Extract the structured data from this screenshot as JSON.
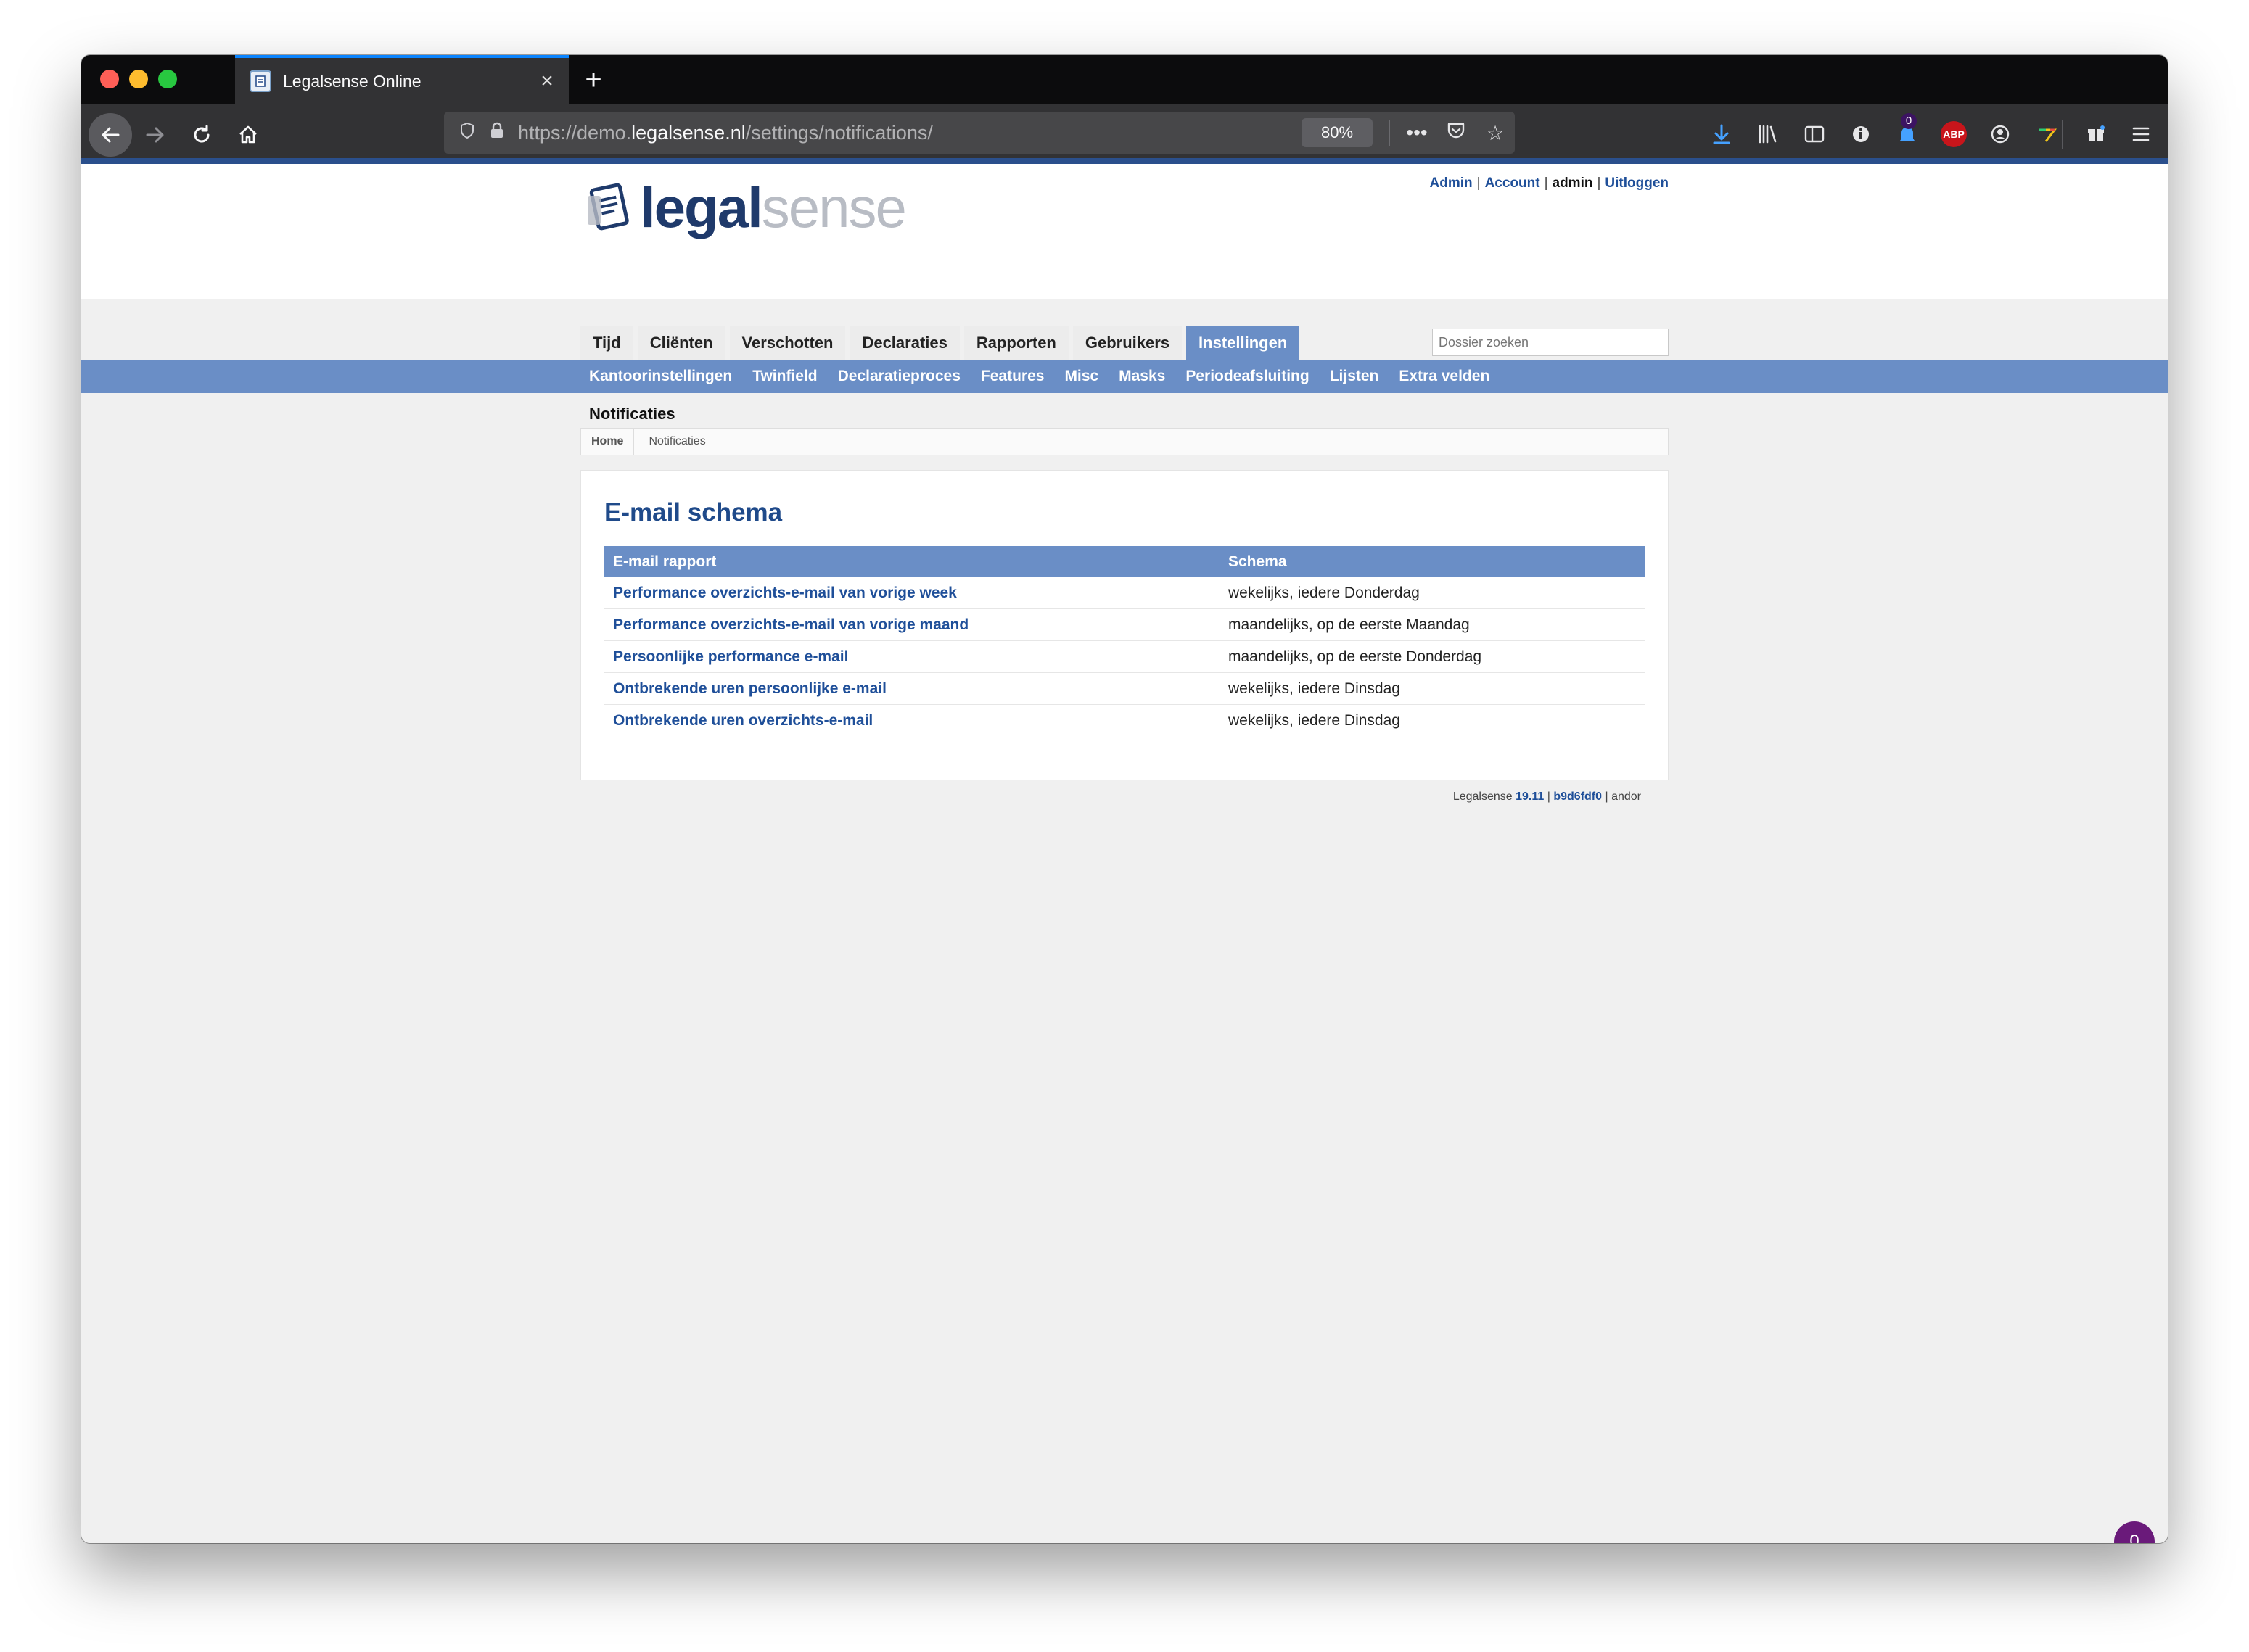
{
  "browser": {
    "tab_title": "Legalsense Online",
    "new_tab_symbol": "+",
    "url_prefix": "https://demo.",
    "url_domain": "legalsense.nl",
    "url_path": "/settings/notifications/",
    "zoom": "80%",
    "notification_count": "0",
    "abp_label": "ABP"
  },
  "header": {
    "logo_part1": "legal",
    "logo_part2": "sense",
    "links": {
      "admin": "Admin",
      "account": "Account",
      "user": "admin",
      "logout": "Uitloggen",
      "separator": "|"
    },
    "search_placeholder": "Dossier zoeken"
  },
  "main_tabs": [
    "Tijd",
    "Cliënten",
    "Verschotten",
    "Declaraties",
    "Rapporten",
    "Gebruikers",
    "Instellingen"
  ],
  "active_tab": "Instellingen",
  "sub_nav": [
    "Kantoorinstellingen",
    "Twinfield",
    "Declaratieproces",
    "Features",
    "Misc",
    "Masks",
    "Periodeafsluiting",
    "Lijsten",
    "Extra velden"
  ],
  "page_title": "Notificaties",
  "breadcrumb": {
    "home": "Home",
    "current": "Notificaties"
  },
  "panel": {
    "title": "E-mail schema",
    "columns": [
      "E-mail rapport",
      "Schema"
    ],
    "rows": [
      {
        "report": "Performance overzichts-e-mail van vorige week",
        "schedule": "wekelijks, iedere Donderdag"
      },
      {
        "report": "Performance overzichts-e-mail van vorige maand",
        "schedule": "maandelijks, op de eerste Maandag"
      },
      {
        "report": "Persoonlijke performance e-mail",
        "schedule": "maandelijks, op de eerste Donderdag"
      },
      {
        "report": "Ontbrekende uren persoonlijke e-mail",
        "schedule": "wekelijks, iedere Dinsdag"
      },
      {
        "report": "Ontbrekende uren overzichts-e-mail",
        "schedule": "wekelijks, iedere Dinsdag"
      }
    ]
  },
  "footer": {
    "product": "Legalsense",
    "version": "19.11",
    "commit": "b9d6fdf0",
    "host": "andor",
    "separator": "|"
  },
  "chat": {
    "count": "0"
  },
  "colors": {
    "accent_blue": "#6a8ec6",
    "link_blue": "#1f4f99",
    "title_blue": "#1f4a8a",
    "chrome_dark": "#323234",
    "chat_purple": "#6a1a7a"
  }
}
